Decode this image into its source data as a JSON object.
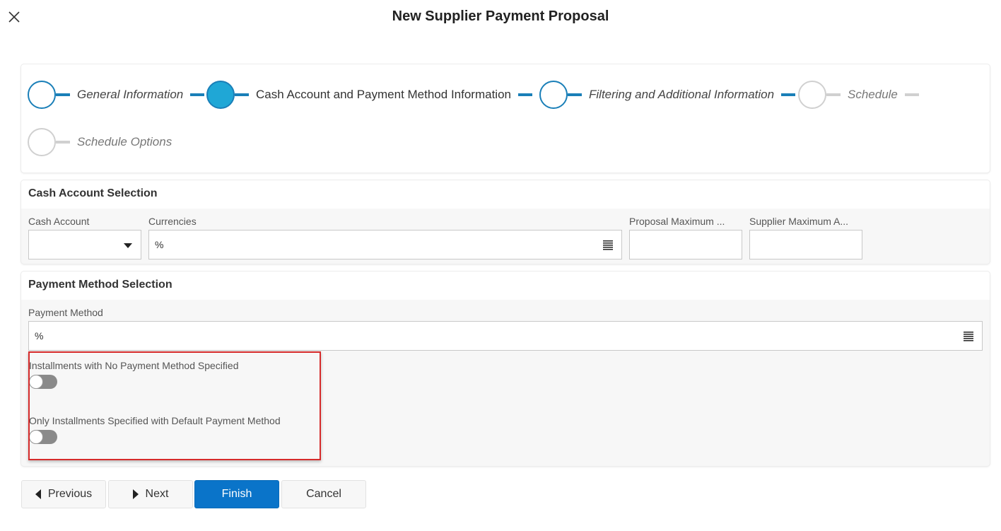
{
  "dialog": {
    "title": "New Supplier Payment Proposal"
  },
  "stepper": {
    "steps": [
      {
        "label": "General Information",
        "state": "completed"
      },
      {
        "label": "Cash Account and Payment Method Information",
        "state": "active"
      },
      {
        "label": "Filtering and Additional Information",
        "state": "completed"
      },
      {
        "label": "Schedule",
        "state": "pending"
      },
      {
        "label": "Schedule Options",
        "state": "pending"
      }
    ]
  },
  "cash_account_section": {
    "title": "Cash Account Selection",
    "cash_account_label": "Cash Account",
    "cash_account_value": "",
    "currencies_label": "Currencies",
    "currencies_value": "%",
    "proposal_max_label": "Proposal Maximum ...",
    "proposal_max_value": "",
    "supplier_max_label": "Supplier Maximum A...",
    "supplier_max_value": ""
  },
  "payment_method_section": {
    "title": "Payment Method Selection",
    "payment_method_label": "Payment Method",
    "payment_method_value": "%",
    "toggle1_label": "Installments with No Payment Method Specified",
    "toggle1_on": false,
    "toggle2_label": "Only Installments Specified with Default Payment Method",
    "toggle2_on": false
  },
  "buttons": {
    "previous": "Previous",
    "next": "Next",
    "finish": "Finish",
    "cancel": "Cancel"
  },
  "colors": {
    "accent": "#1a7fb8",
    "active_step": "#1fa7d6",
    "primary_button": "#0a74c9",
    "highlight": "#d62b2b"
  }
}
